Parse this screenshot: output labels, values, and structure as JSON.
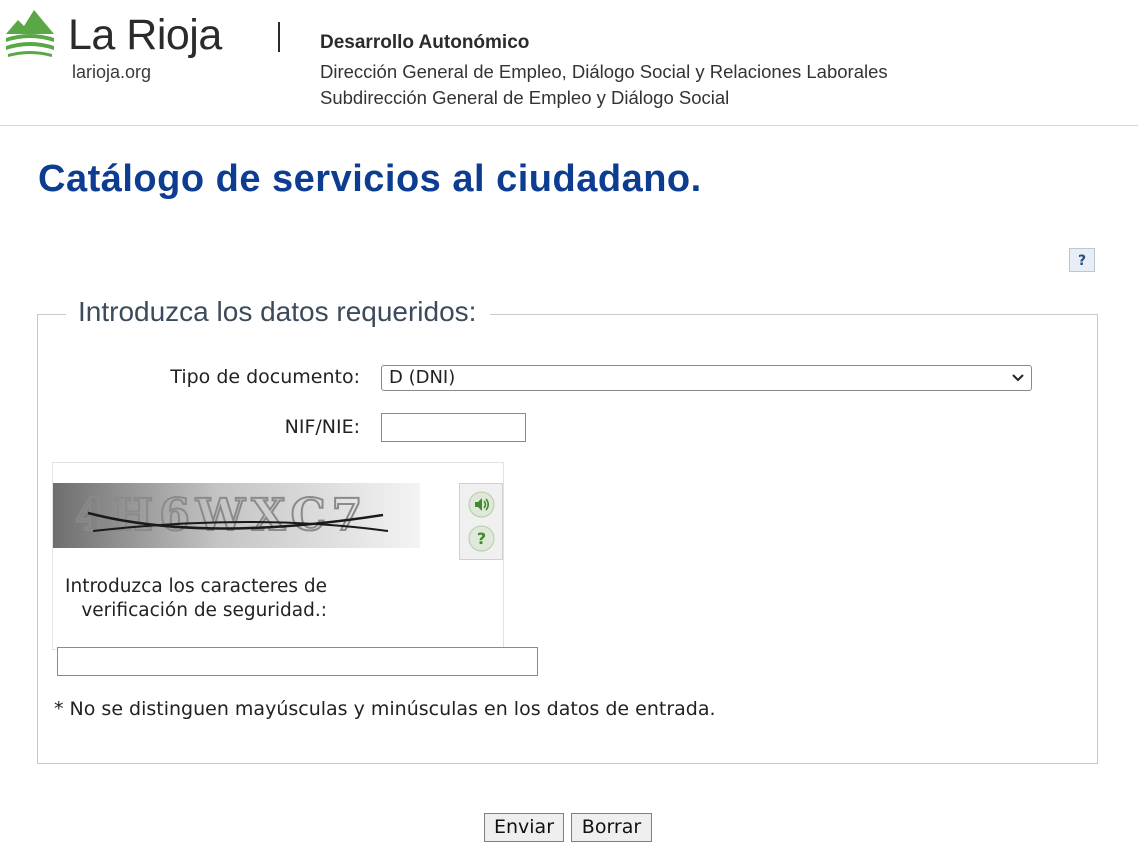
{
  "header": {
    "brand": "La Rioja",
    "brand_url": "larioja.org",
    "department": "Desarrollo Autonómico",
    "general_direction": "Dirección General de Empleo, Diálogo Social y Relaciones Laborales",
    "subdirection": "Subdirección General de Empleo y Diálogo Social"
  },
  "page": {
    "title": "Catálogo de servicios al ciudadano.",
    "help_label": "?"
  },
  "form": {
    "legend": "Introduzca los datos requeridos:",
    "doc_type_label": "Tipo de documento:",
    "doc_type_value": "D (DNI)",
    "nif_label": "NIF/NIE:",
    "nif_value": "",
    "captcha_prompt": "Introduzca los caracteres de verificación de seguridad.:",
    "captcha_value": "",
    "captcha_text": "4H6WXC7",
    "case_note": "* No se distinguen mayúsculas y minúsculas en los datos de entrada.",
    "submit_label": "Enviar",
    "reset_label": "Borrar"
  },
  "colors": {
    "title": "#0d3d91",
    "logo_green": "#59a845"
  }
}
